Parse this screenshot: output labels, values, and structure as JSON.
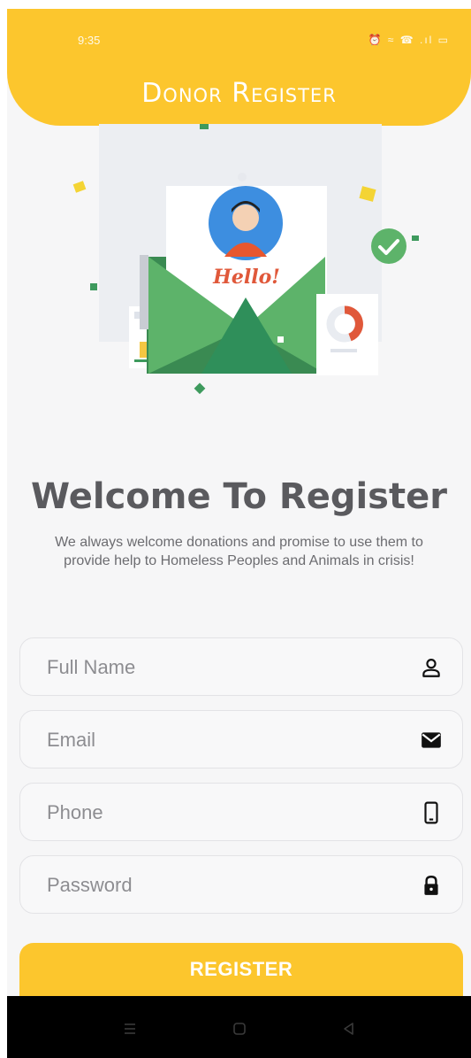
{
  "status_bar": {
    "time": "9:35",
    "icons_text": "⏰ ≈ ☎ .ıl ▭"
  },
  "header": {
    "title": "Donor Register"
  },
  "illustration": {
    "greeting": "Hello!"
  },
  "welcome": {
    "title": "Welcome To Register",
    "text": "We always welcome donations and promise to use them to provide help to Homeless Peoples and Animals in crisis!"
  },
  "form": {
    "full_name": {
      "placeholder": "Full Name",
      "value": "",
      "icon": "user-icon"
    },
    "email": {
      "placeholder": "Email",
      "value": "",
      "icon": "mail-icon"
    },
    "phone": {
      "placeholder": "Phone",
      "value": "",
      "icon": "phone-icon"
    },
    "password": {
      "placeholder": "Password",
      "value": "",
      "icon": "lock-icon"
    },
    "submit_label": "REGISTER"
  },
  "colors": {
    "primary": "#fcc62d",
    "title": "#5a5a5e",
    "field_border": "#e3e3e6"
  }
}
